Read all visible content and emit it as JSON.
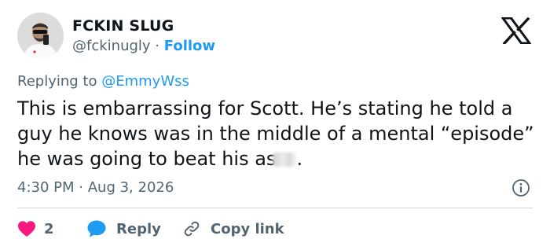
{
  "author": {
    "name": "FCKIN SLUG",
    "handle": "@fckinugly",
    "separator": "·",
    "follow_label": "Follow"
  },
  "reply_context": {
    "prefix": "Replying to",
    "mention": "@EmmyWss"
  },
  "tweet": {
    "text": "This is embarrassing for Scott. He’s stating he told a guy he knows was in the middle of a mental “episode” he was going to beat his as",
    "text_end": "."
  },
  "meta": {
    "time": "4:30 PM",
    "separator": "·",
    "date": "Aug 3, 2026"
  },
  "actions": {
    "like_count": "2",
    "reply_label": "Reply",
    "copy_label": "Copy link"
  },
  "colors": {
    "accent": "#1d9bf0",
    "like": "#f91880",
    "secondary_text": "#536471"
  },
  "icons": {
    "brand": "x-logo-icon",
    "info": "info-icon",
    "like": "heart-icon",
    "reply": "speech-bubble-icon",
    "copy": "link-icon"
  }
}
